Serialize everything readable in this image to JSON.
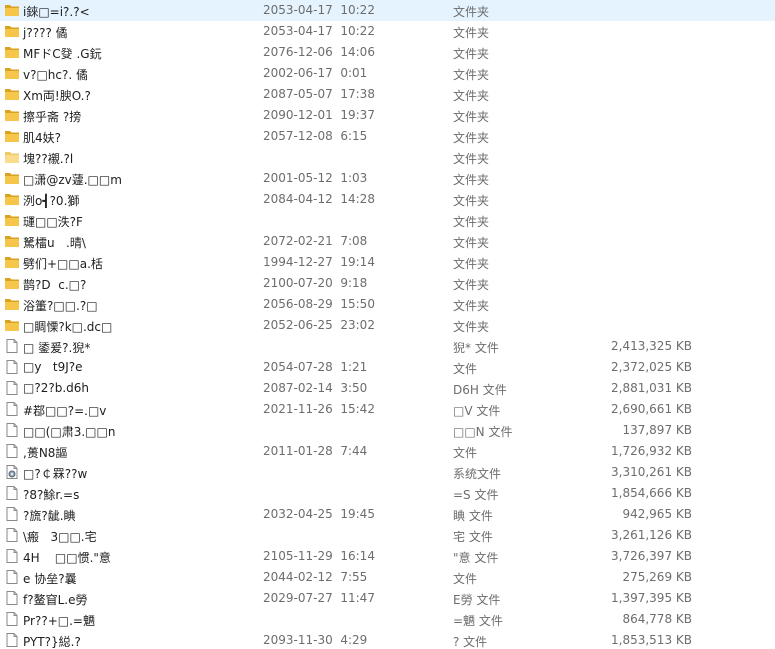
{
  "colors": {
    "folder": "#f5c64a",
    "folder_dark": "#d9a21f",
    "file_border": "#8a8a8a"
  },
  "rows": [
    {
      "icon": "folder-icon",
      "name": "i錸□=i?.?<",
      "date": "2053-04-17  10:22",
      "type": "文件夹",
      "size": ""
    },
    {
      "icon": "folder-icon",
      "name": "j???? 僪",
      "date": "2053-04-17  10:22",
      "type": "文件夹",
      "size": ""
    },
    {
      "icon": "folder-icon",
      "name": "MFドC癹 .G鈨",
      "date": "2076-12-06  14:06",
      "type": "文件夹",
      "size": ""
    },
    {
      "icon": "folder-icon",
      "name": "v?□hc?. 僪",
      "date": "2002-06-17  0:01",
      "type": "文件夹",
      "size": ""
    },
    {
      "icon": "folder-icon",
      "name": "Xm両!腴O.?",
      "date": "2087-05-07  17:38",
      "type": "文件夹",
      "size": ""
    },
    {
      "icon": "folder-icon",
      "name": "擦乎斋 ?搒",
      "date": "2090-12-01  19:37",
      "type": "文件夹",
      "size": ""
    },
    {
      "icon": "folder-icon",
      "name": "肌4妋?",
      "date": "2057-12-08  6:15",
      "type": "文件夹",
      "size": ""
    },
    {
      "icon": "folder-icon-light",
      "name": "塊??襯.?l",
      "date": "",
      "type": "文件夹",
      "size": ""
    },
    {
      "icon": "folder-icon",
      "name": "□潇@zv蘧.□□m",
      "date": "2001-05-12  1:03",
      "type": "文件夹",
      "size": ""
    },
    {
      "icon": "folder-icon",
      "name": "洌o┫?0.獅",
      "date": "2084-04-12  14:28",
      "type": "文件夹",
      "size": ""
    },
    {
      "icon": "folder-icon",
      "name": "璭□□泆?F",
      "date": "",
      "type": "文件夹",
      "size": ""
    },
    {
      "icon": "folder-icon",
      "name": "駑檑u   .晴\\",
      "date": "2072-02-21  7:08",
      "type": "文件夹",
      "size": ""
    },
    {
      "icon": "folder-icon",
      "name": "劈们+□□a.栝",
      "date": "1994-12-27  19:14",
      "type": "文件夹",
      "size": ""
    },
    {
      "icon": "folder-icon",
      "name": "鹊?D  c.□?",
      "date": "2100-07-20  9:18",
      "type": "文件夹",
      "size": ""
    },
    {
      "icon": "folder-icon",
      "name": "浴箽?□□.?□",
      "date": "2056-08-29  15:50",
      "type": "文件夹",
      "size": ""
    },
    {
      "icon": "folder-icon",
      "name": "□睭慄?k□.dc□",
      "date": "2052-06-25  23:02",
      "type": "文件夹",
      "size": ""
    },
    {
      "icon": "file-icon",
      "name": "□ 鋈爰?.猊*",
      "date": "",
      "type": "猊* 文件",
      "size": "2,413,325 KB"
    },
    {
      "icon": "file-icon",
      "name": "□y   t9J?e",
      "date": "2054-07-28  1:21",
      "type": "文件",
      "size": "2,372,025 KB"
    },
    {
      "icon": "file-icon",
      "name": "□?2?b.d6h",
      "date": "2087-02-14  3:50",
      "type": "D6H 文件",
      "size": "2,881,031 KB"
    },
    {
      "icon": "file-icon",
      "name": "#鄀□□?=.□v",
      "date": "2021-11-26  15:42",
      "type": "□V 文件",
      "size": "2,690,661 KB"
    },
    {
      "icon": "file-icon",
      "name": "□□(□肃3.□□n",
      "date": "",
      "type": "□□N 文件",
      "size": "137,897 KB"
    },
    {
      "icon": "file-icon",
      "name": ",蒉N8謳",
      "date": "2011-01-28  7:44",
      "type": "文件",
      "size": "1,726,932 KB"
    },
    {
      "icon": "system-file-icon",
      "name": "□?￠罧??w",
      "date": "",
      "type": "系统文件",
      "size": "3,310,261 KB"
    },
    {
      "icon": "file-icon",
      "name": "?8?鮽r.=s",
      "date": "",
      "type": "=S 文件",
      "size": "1,854,666 KB"
    },
    {
      "icon": "file-icon",
      "name": "?旒?龇.睓",
      "date": "2032-04-25  19:45",
      "type": "睓 文件",
      "size": "942,965 KB"
    },
    {
      "icon": "file-icon",
      "name": "\\瘢   3□□.宅",
      "date": "",
      "type": "宅 文件",
      "size": "3,261,126 KB"
    },
    {
      "icon": "file-icon",
      "name": "4H    □□惯.\"意",
      "date": "2105-11-29  16:14",
      "type": "\"意 文件",
      "size": "3,726,397 KB"
    },
    {
      "icon": "file-icon",
      "name": "e 协垒?曩",
      "date": "2044-02-12  7:55",
      "type": "文件",
      "size": "275,269 KB"
    },
    {
      "icon": "file-icon",
      "name": "f?鳌窅L.e勞",
      "date": "2029-07-27  11:47",
      "type": "E勞 文件",
      "size": "1,397,395 KB"
    },
    {
      "icon": "file-icon",
      "name": "Pr??+□.=魉",
      "date": "",
      "type": "=魉 文件",
      "size": "864,778 KB"
    },
    {
      "icon": "file-icon",
      "name": "PYT?}縂.?",
      "date": "2093-11-30  4:29",
      "type": "? 文件",
      "size": "1,853,513 KB"
    }
  ]
}
